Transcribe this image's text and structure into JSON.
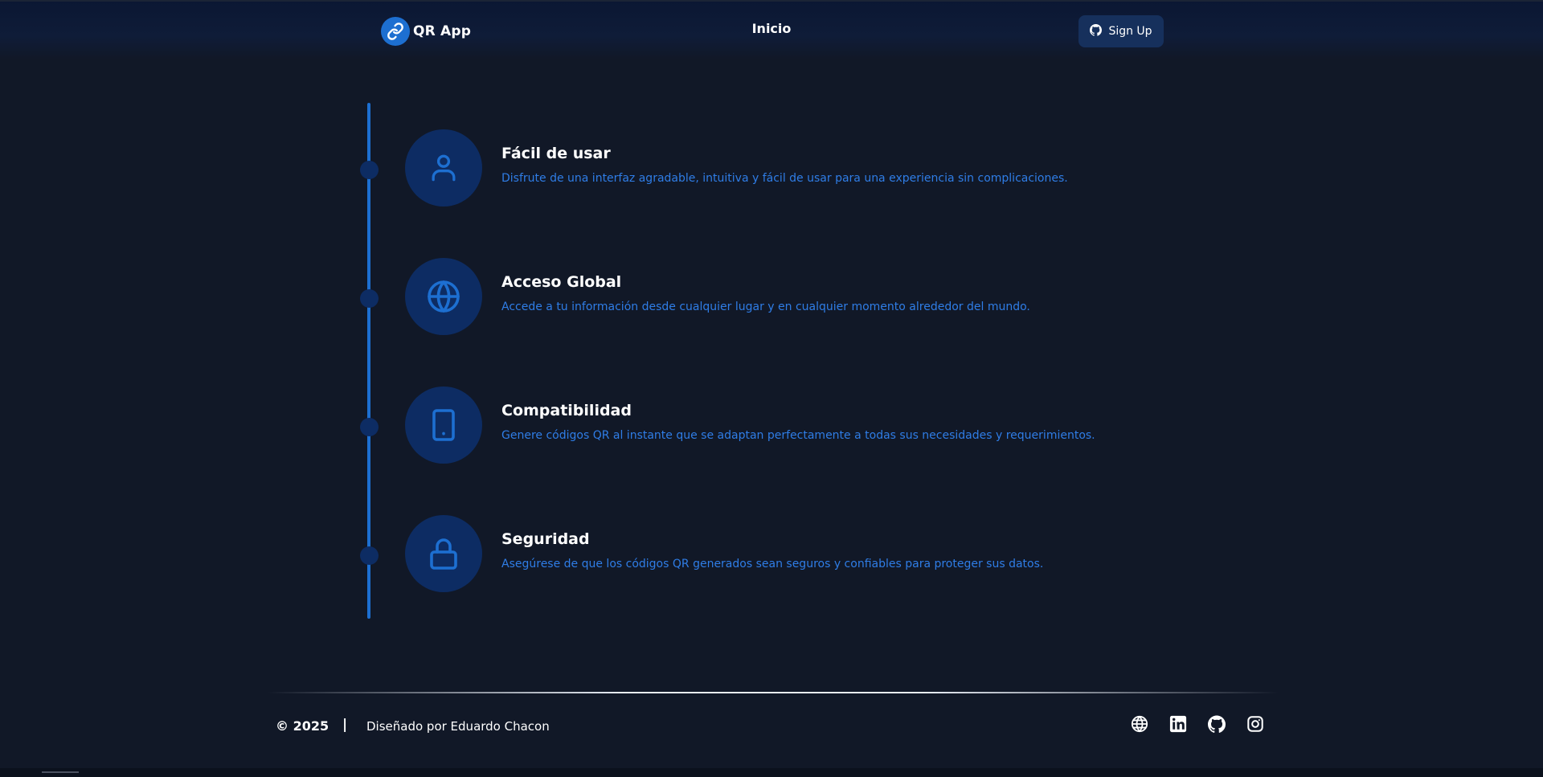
{
  "header": {
    "brand_name": "QR App",
    "brand_icon": "link-icon",
    "nav_home": "Inicio",
    "signup_label": "Sign Up",
    "signup_icon": "github-icon"
  },
  "features": [
    {
      "title": "Fácil de usar",
      "description": "Disfrute de una interfaz agradable, intuitiva y fácil de usar para una experiencia sin complicaciones.",
      "icon": "user-icon"
    },
    {
      "title": "Acceso Global",
      "description": "Accede a tu información desde cualquier lugar y en cualquier momento alrededor del mundo.",
      "icon": "globe-icon"
    },
    {
      "title": "Compatibilidad",
      "description": "Genere códigos QR al instante que se adaptan perfectamente a todas sus necesidades y requerimientos.",
      "icon": "tablet-icon"
    },
    {
      "title": "Seguridad",
      "description": "Asegúrese de que los códigos QR generados sean seguros y confiables para proteger sus datos.",
      "icon": "lock-icon"
    }
  ],
  "footer": {
    "copyright": "© 2025",
    "separator": "|",
    "designer": "Diseñado por Eduardo Chacon",
    "social": [
      "globe-icon",
      "linkedin-icon",
      "github-icon",
      "instagram-icon"
    ]
  },
  "colors": {
    "background": "#111827",
    "accent": "#1d6fd1",
    "icon_circle": "#0d2c63",
    "description_text": "#2f7de6",
    "button_bg": "#16305c"
  }
}
